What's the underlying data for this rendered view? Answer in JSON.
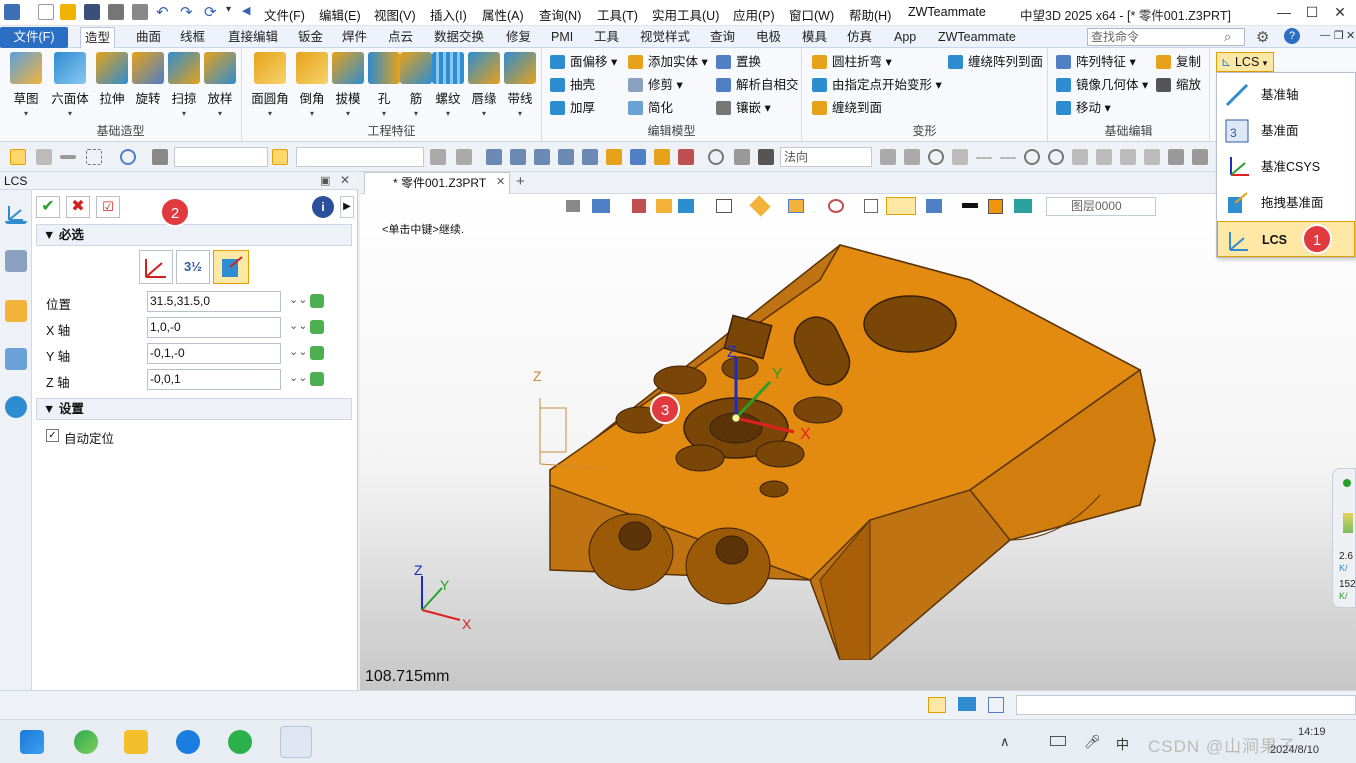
{
  "menubar": {
    "items": [
      "文件(F)",
      "编辑(E)",
      "视图(V)",
      "插入(I)",
      "属性(A)",
      "查询(N)",
      "工具(T)",
      "实用工具(U)",
      "应用(P)",
      "窗口(W)",
      "帮助(H)",
      "ZWTeammate"
    ],
    "app_title": "中望3D 2025 x64 - [* 零件001.Z3PRT]"
  },
  "tabs": {
    "file": "文件(F)",
    "items": [
      "造型",
      "曲面",
      "线框",
      "直接编辑",
      "钣金",
      "焊件",
      "点云",
      "数据交换",
      "修复",
      "PMI",
      "工具",
      "视觉样式",
      "查询",
      "电极",
      "模具",
      "仿真",
      "App",
      "ZWTeammate"
    ],
    "active_index": 0,
    "search_placeholder": "查找命令"
  },
  "ribbon": {
    "groups": [
      {
        "label": "基础造型",
        "buttons": [
          "草图",
          "六面体",
          "拉伸",
          "旋转",
          "扫掠",
          "放样"
        ]
      },
      {
        "label": "工程特征",
        "buttons": [
          "面圆角",
          "倒角",
          "拔模",
          "孔",
          "筋",
          "螺纹",
          "唇缘",
          "带线"
        ]
      },
      {
        "label": "编辑模型",
        "small": [
          "面偏移",
          "添加实体",
          "置换",
          "抽壳",
          "修剪",
          "解析自相交",
          "加厚",
          "简化",
          "镶嵌"
        ]
      },
      {
        "label": "变形",
        "small": [
          "圆柱折弯",
          "缠绕阵列到面",
          "由指定点开始变形",
          "缠绕到面"
        ]
      },
      {
        "label": "基础编辑",
        "small": [
          "阵列特征",
          "复制",
          "镜像几何体",
          "缩放",
          "移动"
        ]
      }
    ],
    "lcs_label": "LCS"
  },
  "toolbar2": {
    "combo_normal": "法向"
  },
  "panel": {
    "title": "LCS",
    "section_required": "必选",
    "fields": [
      {
        "label": "位置",
        "value": "31.5,31.5,0"
      },
      {
        "label": "X 轴",
        "value": "1,0,-0"
      },
      {
        "label": "Y 轴",
        "value": "-0,1,-0"
      },
      {
        "label": "Z 轴",
        "value": "-0,0,1"
      }
    ],
    "section_settings": "设置",
    "auto_locate": "自动定位"
  },
  "doc_tab": "* 零件001.Z3PRT",
  "viewport": {
    "hint": "<单击中键>继续.",
    "layer": "图层0000",
    "scale": "108.715mm",
    "axis_labels": {
      "x": "X",
      "y": "Y",
      "z": "Z"
    },
    "perf1": "2.6",
    "perf2": "152",
    "perf_unit": "K/"
  },
  "dropdown": {
    "items": [
      "基准轴",
      "基准面",
      "基准CSYS",
      "拖拽基准面",
      "LCS"
    ]
  },
  "badges": [
    "1",
    "2",
    "3"
  ],
  "taskbar": {
    "time": "14:19",
    "date": "2024/8/10",
    "watermark": "CSDN @山涧果子",
    "ime": "中"
  },
  "colors": {
    "part": "#e38a10",
    "accent": "#2b6fc5",
    "badge": "#e0393e"
  }
}
